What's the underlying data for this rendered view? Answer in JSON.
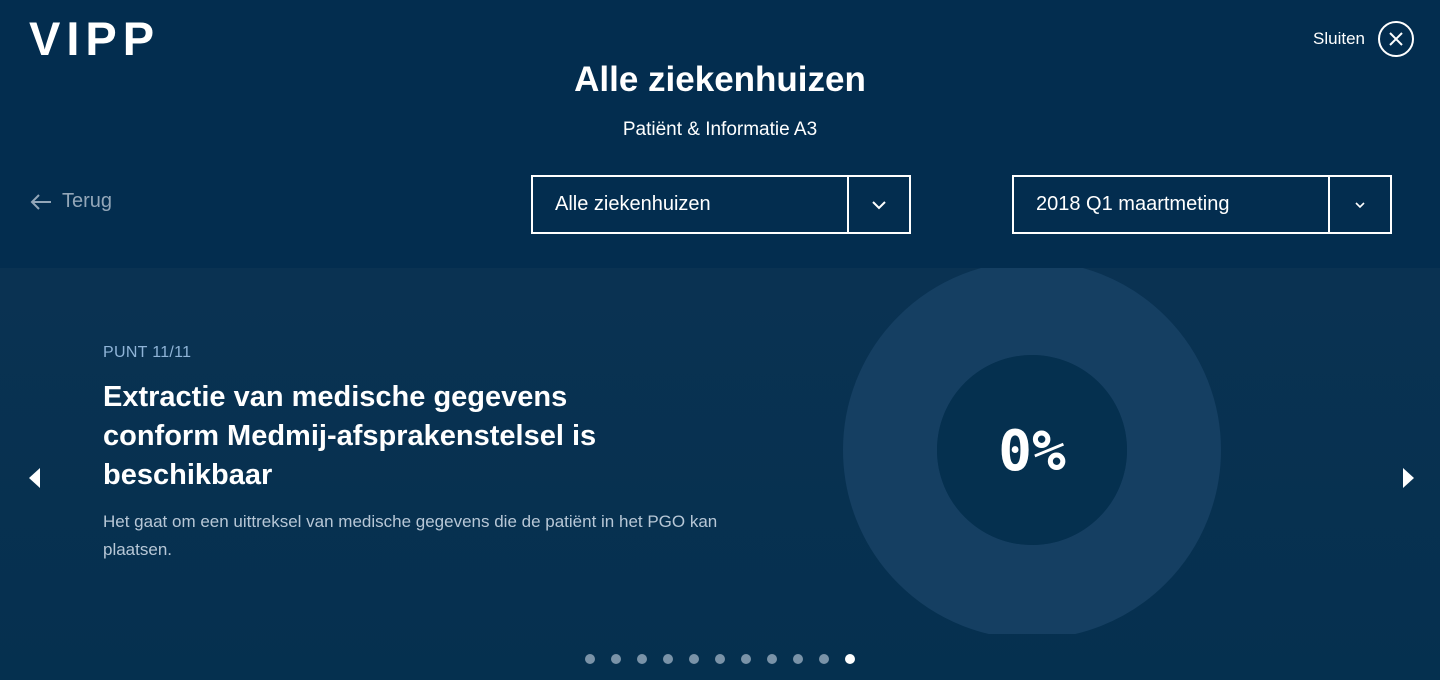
{
  "header": {
    "logo": "VIPP",
    "close_label": "Sluiten",
    "title": "Alle ziekenhuizen",
    "subtitle": "Patiënt & Informatie A3",
    "back_label": "Terug",
    "hospital_select": "Alle ziekenhuizen",
    "measurement_select": "2018 Q1 maartmeting"
  },
  "slide": {
    "point_label": "PUNT 11/11",
    "title": "Extractie van medische gegevens conform Medmij-afsprakenstelsel is beschikbaar",
    "description": "Het gaat om een uittreksel van medische gegevens die de patiënt in het PGO kan plaatsen.",
    "percentage_text": "0%",
    "percentage_value": 0
  },
  "pagination": {
    "total": 11,
    "active_index": 10
  },
  "colors": {
    "background": "#032d4f",
    "donut": "#153f62",
    "muted_text": "#93a6b8",
    "accent_label": "#8fb4d7"
  },
  "icons": {
    "close": "close-icon",
    "back": "arrow-left-icon",
    "dropdown": "chevron-down-icon",
    "prev": "triangle-left-icon",
    "next": "triangle-right-icon"
  }
}
